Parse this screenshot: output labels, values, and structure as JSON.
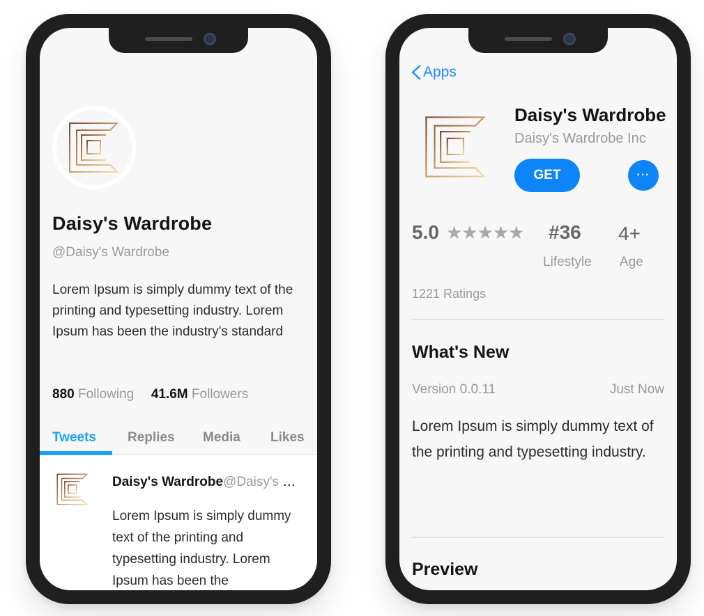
{
  "profile": {
    "name": "Daisy's Wardrobe",
    "handle": "@Daisy's Wardrobe",
    "bio": "Lorem Ipsum is simply dummy text of the printing and typesetting industry. Lorem Ipsum has been the industry's standard",
    "following_count": "880",
    "following_label": "Following",
    "followers_count": "41.6M",
    "followers_label": "Followers",
    "tabs": [
      "Tweets",
      "Replies",
      "Media",
      "Likes"
    ],
    "active_tab": "Tweets",
    "tweet": {
      "author": "Daisy's Wardrobe",
      "handle": "@Daisy's Wardrobe",
      "text": "Lorem Ipsum is simply dummy text of the printing and typesetting industry. Lorem Ipsum has been the"
    }
  },
  "appstore": {
    "back_label": "Apps",
    "title": "Daisy's Wardrobe",
    "developer": "Daisy's Wardrobe Inc",
    "get_label": "GET",
    "more_label": "···",
    "rating": "5.0",
    "stars": "★★★★★",
    "rank": "#36",
    "rank_category": "Lifestyle",
    "age_rating": "4+",
    "age_label": "Age",
    "ratings_count": "1221 Ratings",
    "whats_new_title": "What's New",
    "version": "Version 0.0.11",
    "released": "Just Now",
    "whats_new_text": "Lorem Ipsum is simply dummy text of the printing and typesetting industry.",
    "preview_title": "Preview"
  },
  "icons": {
    "brand_logo": "brand-logo-icon",
    "back": "chevron-left-icon"
  },
  "colors": {
    "twitter_blue": "#1da1f2",
    "appstore_blue": "#0d84f7",
    "phone_frame": "#1f1f1f",
    "screen_bg": "#f7f7f8"
  }
}
